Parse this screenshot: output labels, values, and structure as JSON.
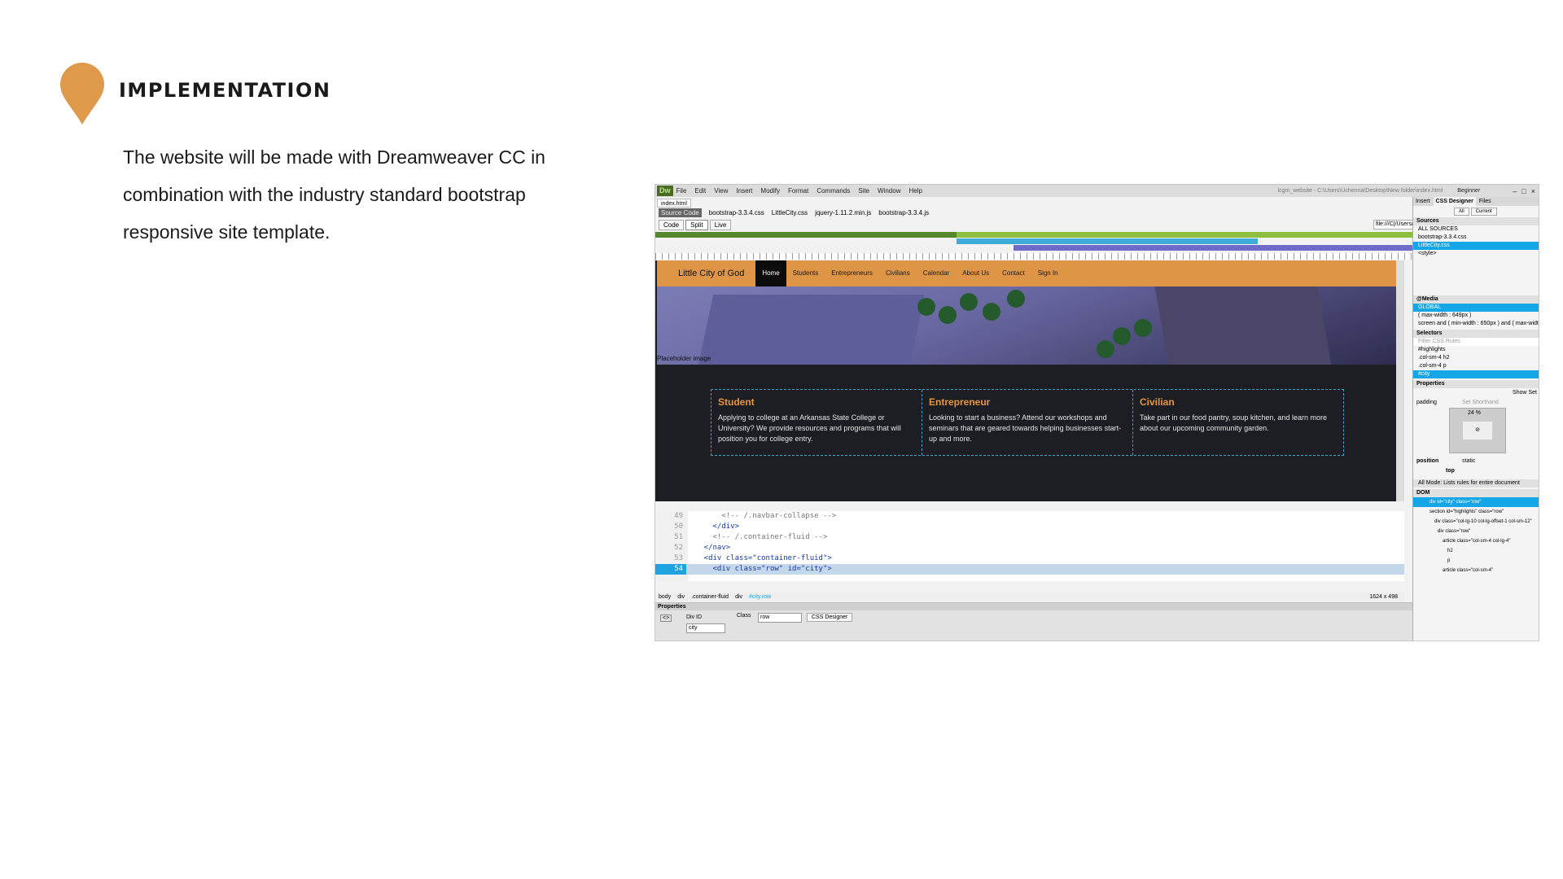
{
  "slide": {
    "heading": "IMPLEMENTATION",
    "body": "The website will be made with Dreamweaver CC in combination with the industry standard bootstrap responsive site template.",
    "accent_color": "#de9a4a",
    "pin_icon": "location-pin-icon"
  },
  "app": {
    "logo": "Dw",
    "menu": [
      "File",
      "Edit",
      "View",
      "Insert",
      "Modify",
      "Format",
      "Commands",
      "Site",
      "Window",
      "Help"
    ],
    "title": "lcgm_website - C:\\Users\\Uchenna\\Desktop\\New folder\\index.html",
    "workspace": "Beginner"
  },
  "document": {
    "tab": "index.html",
    "related_files": [
      "Source Code",
      "bootstrap-3.3.4.css",
      "LittleCity.css",
      "jquery-1.11.2.min.js",
      "bootstrap-3.3.4.js"
    ],
    "view_buttons": [
      "Code",
      "Split",
      "Live"
    ],
    "address": "file:///C|/Users/Uchenna/Desktop/Ne"
  },
  "site": {
    "brand": "Little City of God",
    "nav": [
      "Home",
      "Students",
      "Entrepreneurs",
      "Civilians",
      "Calendar",
      "About Us",
      "Contact",
      "Sign In"
    ],
    "placeholder_label": "Placeholder image",
    "columns": [
      {
        "title": "Student",
        "text": "Applying to college at an Arkansas State College or University? We provide resources and programs that will position you for college entry."
      },
      {
        "title": "Entrepreneur",
        "text": "Looking to start a business? Attend our workshops and seminars that are geared towards helping businesses start-up and more."
      },
      {
        "title": "Civilian",
        "text": "Take part in our food pantry, soup kitchen, and learn more about our upcoming community garden."
      }
    ]
  },
  "code": {
    "lines": [
      {
        "n": "49",
        "text": "        <!-- /.navbar-collapse -->"
      },
      {
        "n": "50",
        "text": "      </div>"
      },
      {
        "n": "51",
        "text": "      <!-- /.container-fluid -->"
      },
      {
        "n": "52",
        "text": "    </nav>"
      },
      {
        "n": "53",
        "text": "    <div class=\"container-fluid\">"
      },
      {
        "n": "54",
        "text": "      <div class=\"row\" id=\"city\">"
      }
    ]
  },
  "status": {
    "breadcrumb": [
      "body",
      "div",
      ".container-fluid",
      "div",
      "#city.row"
    ],
    "dims": "1624 x 498"
  },
  "properties": {
    "title": "Properties",
    "div_id_label": "Div ID",
    "div_id_value": "city",
    "class_label": "Class",
    "class_value": "row",
    "css_designer_button": "CSS Designer"
  },
  "panel": {
    "tabs": [
      "Insert",
      "CSS Designer",
      "Files"
    ],
    "toggle": [
      "All",
      "Current"
    ],
    "sources_header": "Sources",
    "sources": [
      "ALL SOURCES",
      "bootstrap-3.3.4.css",
      "LittleCity.css",
      "<style>"
    ],
    "media_header": "@Media",
    "media": [
      "GLOBAL",
      "( max-width : 649px )",
      "screen and ( min-width : 650px ) and ( max-widt..."
    ],
    "selectors_header": "Selectors",
    "selector_filter": "Filter CSS Rules",
    "selectors": [
      "#highlights",
      ".col-sm-4 h2",
      ".col-sm-4 p",
      "#city"
    ],
    "properties_header": "Properties",
    "show_set": "Show Set",
    "padding_label": "padding",
    "padding_value": "Set Shorthand",
    "padding_top": "24 %",
    "position_label": "position",
    "position_value": "static",
    "top_label": "top",
    "footnote": "All Mode: Lists rules for entire document",
    "dom_header": "DOM",
    "dom": [
      "div id=\"city\" class=\"row\"",
      "section id=\"highlights\" class=\"row\"",
      "div class=\"col-lg-10 col-lg-offset-1 col-sm-12\"",
      "div class=\"row\"",
      "article class=\"col-sm-4 col-lg-4\"",
      "h2",
      "p",
      "article class=\"col-sm-4\""
    ]
  }
}
